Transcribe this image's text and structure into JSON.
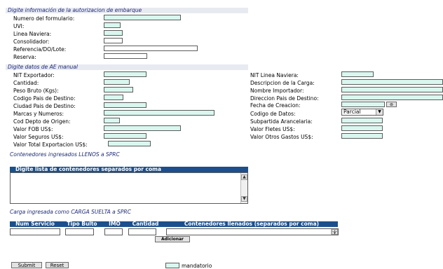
{
  "sections": {
    "authorization": "Digite información de la autorizacion de embarque",
    "ae_manual": "Digite datos de AE manual",
    "llenos": "Contenedores ingresados LLENOS a SPRC",
    "carga_suelta": "Carga ingresada como CARGA SUELTA a SPRC"
  },
  "auth_fields": {
    "numero_formulario": "Numero del formulario:",
    "uvi": "UVI:",
    "linea_naviera": "Linea Naviera:",
    "consolidador": "Consolidador:",
    "referencia": "Referencia/DO/Lote:",
    "reserva": "Reserva:"
  },
  "left_fields": {
    "nit_exportador": "NIT Exportador:",
    "cantidad": "Cantidad:",
    "peso_bruto": "Peso Bruto (Kgs):",
    "codigo_pais_destino": "Codigo Pais de Destino:",
    "ciudad_pais_destino": "Ciudad Pais de Destino:",
    "marcas_numeros": "Marcas y Numeros:",
    "cod_depto_origen": "Cod Depto de Origen:",
    "valor_fob": "Valor FOB US$:",
    "valor_seguros": "Valor Seguros US$:",
    "valor_total": "Valor Total Exportacion US$:"
  },
  "right_fields": {
    "nit_linea_naviera": "NIT Linea Naviera:",
    "descripcion_carga": "Descripcion de la Carga:",
    "nombre_importador": "Nombre Importador:",
    "direccion_pais_destino": "Direccion Pais de Destino:",
    "fecha_creacion": "Fecha de Creacion:",
    "codigo_datos": "Codigo de Datos:",
    "subpartida": "Subpartida Arancelaria:",
    "valor_fletes": "Valor Fletes US$:",
    "valor_otros_gastos": "Valor Otros Gastos US$:"
  },
  "codigo_datos_selected": "Parcial",
  "calendar_icon": "calendar-icon",
  "containers_panel": {
    "title": "Digite lista de contenedores separados por coma"
  },
  "carga_table": {
    "headers": [
      "Num Servicio",
      "Tipo Bulto",
      "IMO",
      "Cantidad",
      "Contenedores llenados (separados por coma)"
    ],
    "add_button": "Adicionar"
  },
  "buttons": {
    "submit": "Submit",
    "reset": "Reset"
  },
  "legend": {
    "mandatory": "mandatorio"
  },
  "colors": {
    "mandatory_fill": "#d9f7ef",
    "section_bar": "#e8eaf2",
    "header_blue": "#1c4f8c"
  }
}
